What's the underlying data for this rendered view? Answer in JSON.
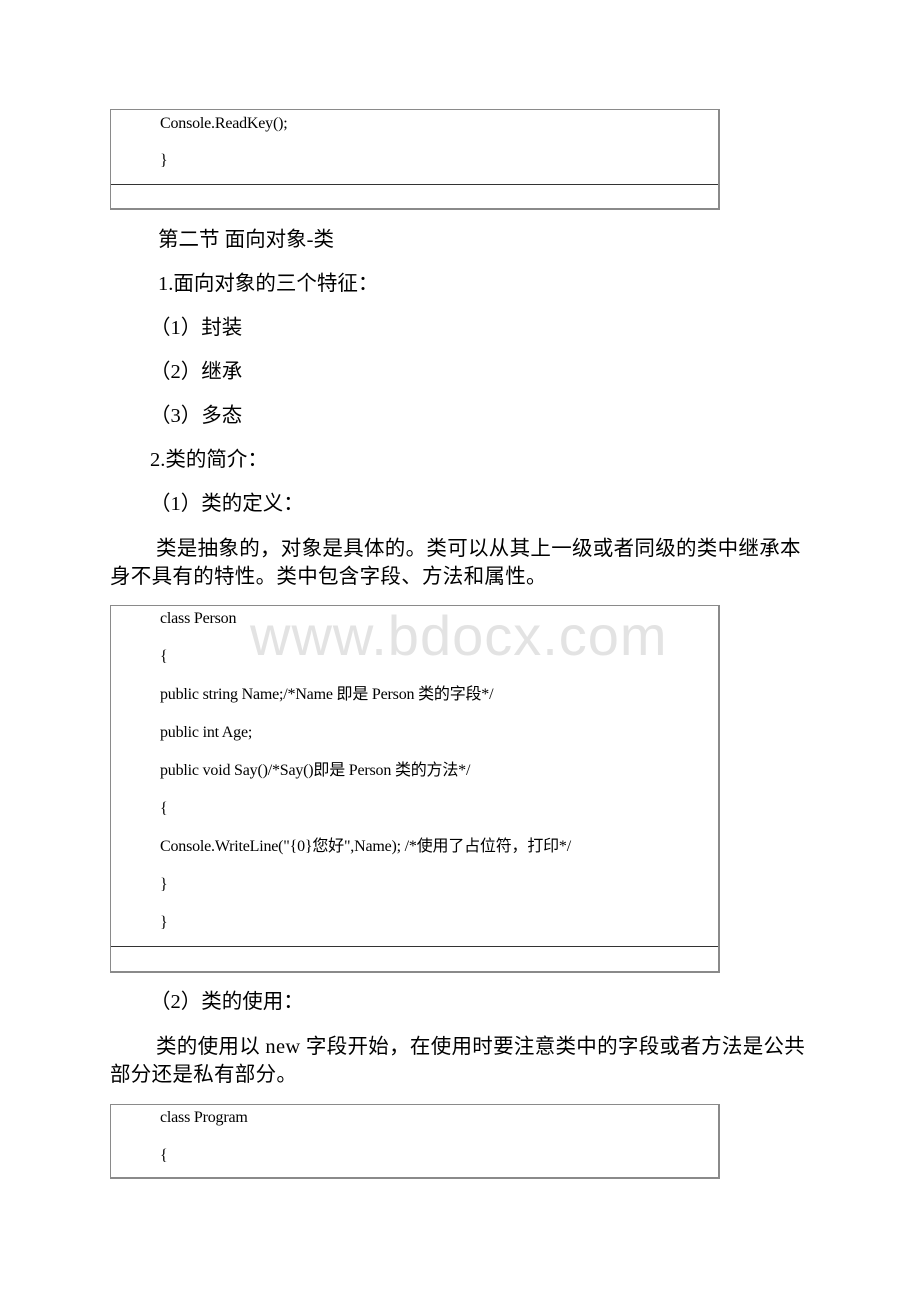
{
  "code_block_1": {
    "lines": [
      "Console.ReadKey();",
      "}"
    ]
  },
  "section": {
    "title": "第二节 面向对象-类",
    "item1": "1.面向对象的三个特征：",
    "features": [
      "（1）封装",
      "（2）继承",
      "（3）多态"
    ],
    "item2": "2.类的简介：",
    "sub1": "（1）类的定义：",
    "para1": "类是抽象的，对象是具体的。类可以从其上一级或者同级的类中继承本身不具有的特性。类中包含字段、方法和属性。"
  },
  "code_block_2": {
    "lines": [
      "class Person",
      "{",
      "public string Name;/*Name 即是 Person 类的字段*/",
      "public int Age;",
      "public void Say()/*Say()即是 Person 类的方法*/",
      "{",
      "Console.WriteLine(\"{0}您好\",Name); /*使用了占位符，打印*/",
      "}",
      "}"
    ]
  },
  "watermark": "www.bdocx.com",
  "section2": {
    "sub2": "（2）类的使用：",
    "para2": "类的使用以 new 字段开始，在使用时要注意类中的字段或者方法是公共部分还是私有部分。"
  },
  "code_block_3": {
    "lines": [
      "class Program",
      "{"
    ]
  }
}
